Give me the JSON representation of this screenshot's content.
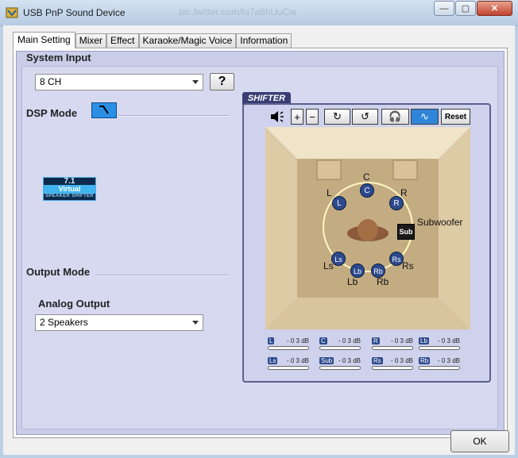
{
  "window": {
    "title": "USB PnP Sound Device",
    "background_text": "pic.twitter.com/hj7a8hUuCw",
    "minimize_label": "—",
    "maximize_label": "▢",
    "close_label": "✕"
  },
  "tabs": [
    {
      "label": "Main Setting",
      "active": true
    },
    {
      "label": "Mixer"
    },
    {
      "label": "Effect"
    },
    {
      "label": "Karaoke/Magic Voice"
    },
    {
      "label": "Information"
    }
  ],
  "system_input": {
    "label": "System Input",
    "selected": "8 CH",
    "help_label": "?"
  },
  "dsp_mode": {
    "label": "DSP Mode",
    "logo": {
      "line1": "7.1",
      "line2": "Virtual",
      "line3": "SPEAKER SHIFTER"
    }
  },
  "output_mode": {
    "label": "Output Mode",
    "analog_label": "Analog Output",
    "selected": "2 Speakers"
  },
  "shifter": {
    "title": "SHIFTER",
    "reset_label": "Reset",
    "speakers": {
      "C": "C",
      "L": "L",
      "R": "R",
      "Ls": "Ls",
      "Rs": "Rs",
      "Lb": "Lb",
      "Rb": "Rb",
      "Sub": "Sub",
      "Subwoofer": "Subwoofer"
    },
    "levels": [
      {
        "tag": "L",
        "value": "- 0 3 dB"
      },
      {
        "tag": "C",
        "value": "- 0 3 dB"
      },
      {
        "tag": "R",
        "value": "- 0 3 dB"
      },
      {
        "tag": "Lb",
        "value": "- 0 3 dB"
      },
      {
        "tag": "Ls",
        "value": "- 0 3 dB"
      },
      {
        "tag": "Sub",
        "value": "- 0 3 dB"
      },
      {
        "tag": "Rs",
        "value": "- 0 3 dB"
      },
      {
        "tag": "Rb",
        "value": "- 0 3 dB"
      }
    ]
  },
  "ok_label": "OK",
  "colors": {
    "accent": "#2f86d8",
    "panel": "#c9cde8",
    "speaker": "#2c4a8c"
  }
}
